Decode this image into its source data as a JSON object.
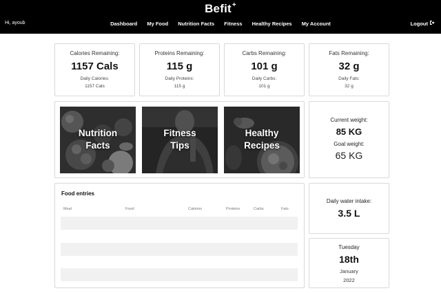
{
  "header": {
    "brand": "Befit",
    "brand_mark": "+",
    "greeting": "Hi, ayoub",
    "nav": [
      "Dashboard",
      "My Food",
      "Nutrition Facts",
      "Fitness",
      "Healthy Recipes",
      "My Account"
    ],
    "logout_label": "Logout",
    "logout_icon": "logout-arrow-icon"
  },
  "stats": [
    {
      "label": "Calories Remaining:",
      "value": "1157 Cals",
      "sub_label": "Daily Calories:",
      "sub_value": "1157 Cals"
    },
    {
      "label": "Proteins Remaining:",
      "value": "115 g",
      "sub_label": "Daily Proteins:",
      "sub_value": "115 g"
    },
    {
      "label": "Carbs Remaining:",
      "value": "101 g",
      "sub_label": "Daily Carbs:",
      "sub_value": "101 g"
    },
    {
      "label": "Fats Remaining:",
      "value": "32 g",
      "sub_label": "Daily Fats:",
      "sub_value": "32 g"
    }
  ],
  "tiles": [
    {
      "line1": "Nutrition",
      "line2": "Facts"
    },
    {
      "line1": "Fitness",
      "line2": "Tips"
    },
    {
      "line1": "Healthy",
      "line2": "Recipes"
    }
  ],
  "weight": {
    "current_label": "Current weight:",
    "current_value": "85 KG",
    "goal_label": "Goal weight:",
    "goal_value": "65 KG"
  },
  "food_entries": {
    "title": "Food entries",
    "columns": [
      "Meal",
      "Food",
      "Calories",
      "Proteins",
      "Carbs",
      "Fats"
    ]
  },
  "water": {
    "label": "Daily water intake:",
    "value": "3.5 L"
  },
  "date": {
    "weekday": "Tuesday",
    "day": "18th",
    "month": "January",
    "year": "2022"
  }
}
